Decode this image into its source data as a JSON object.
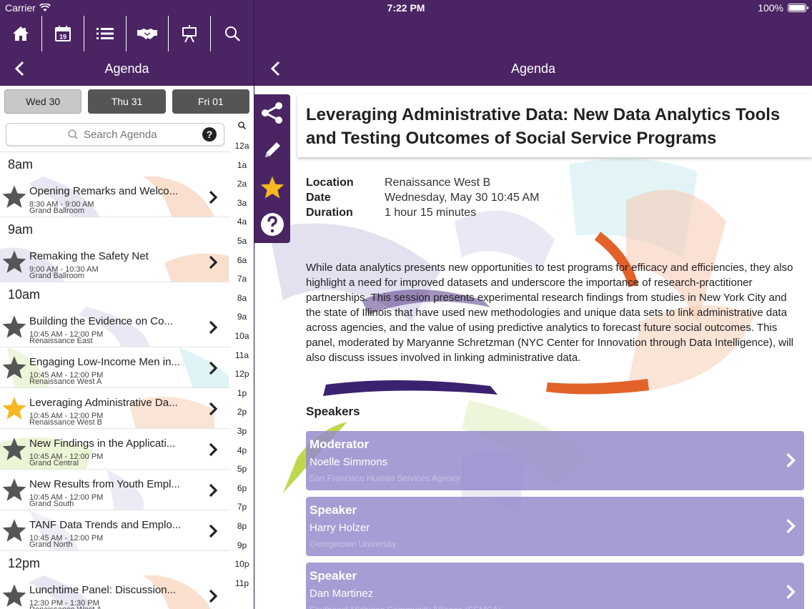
{
  "status_bar": {
    "carrier": "Carrier",
    "time": "7:22 PM",
    "battery": "100%",
    "battery_level": 1.0
  },
  "colors": {
    "header_purple": "#4a2463",
    "speaker_card": "#968ccd",
    "star_gold": "#f5b821",
    "star_gray": "#555555"
  },
  "toolbar": {
    "icons": [
      "home-icon",
      "calendar-icon",
      "list-icon",
      "handshake-icon",
      "presentation-icon",
      "search-icon"
    ],
    "calendar_day": "19"
  },
  "left_nav": {
    "title": "Agenda"
  },
  "day_tabs": [
    {
      "label": "Wed 30",
      "active": true
    },
    {
      "label": "Thu 31",
      "active": false
    },
    {
      "label": "Fri 01",
      "active": false
    }
  ],
  "search": {
    "placeholder": "Search Agenda",
    "help": "?"
  },
  "agenda": [
    {
      "hour": "8am",
      "sessions": [
        {
          "title": "Opening Remarks and Welco...",
          "time": "8:30 AM - 9:00 AM",
          "room": "Grand Ballroom",
          "starred": false
        }
      ]
    },
    {
      "hour": "9am",
      "sessions": [
        {
          "title": "Remaking the Safety Net",
          "time": "9:00 AM - 10:30 AM",
          "room": "Grand Ballroom",
          "starred": false
        }
      ]
    },
    {
      "hour": "10am",
      "sessions": [
        {
          "title": "Building the Evidence on Co...",
          "time": "10:45 AM - 12:00 PM",
          "room": "Renaissance East",
          "starred": false
        },
        {
          "title": "Engaging Low-Income Men in...",
          "time": "10:45 AM - 12:00 PM",
          "room": "Renaissance West A",
          "starred": false
        },
        {
          "title": "Leveraging Administrative Da...",
          "time": "10:45 AM - 12:00 PM",
          "room": "Renaissance West B",
          "starred": true
        },
        {
          "title": "New Findings in the Applicati...",
          "time": "10:45 AM - 12:00 PM",
          "room": "Grand Central",
          "starred": false
        },
        {
          "title": "New Results from Youth Empl...",
          "time": "10:45 AM - 12:00 PM",
          "room": "Grand South",
          "starred": false
        },
        {
          "title": "TANF Data Trends and Emplo...",
          "time": "10:45 AM - 12:00 PM",
          "room": "Grand North",
          "starred": false
        }
      ]
    },
    {
      "hour": "12pm",
      "sessions": [
        {
          "title": "Lunchtime Panel: Discussion...",
          "time": "12:30 PM - 1:30 PM",
          "room": "Renaissance West A",
          "starred": false
        }
      ]
    }
  ],
  "time_index": [
    "12a",
    "1a",
    "2a",
    "3a",
    "4a",
    "5a",
    "6a",
    "7a",
    "8a",
    "9a",
    "10a",
    "11a",
    "12p",
    "1p",
    "2p",
    "3p",
    "4p",
    "5p",
    "6p",
    "7p",
    "8p",
    "9p",
    "10p",
    "11p"
  ],
  "right_nav": {
    "title": "Agenda"
  },
  "detail": {
    "title": "Leveraging Administrative Data: New Data Analytics Tools and Testing Outcomes of Social Service Programs",
    "location_label": "Location",
    "location": "Renaissance West B",
    "date_label": "Date",
    "date": "Wednesday, May 30 10:45 AM",
    "duration_label": "Duration",
    "duration": "1 hour 15 minutes",
    "description": "While data analytics presents new opportunities to test programs for efficacy and efficiencies, they also highlight a need for improved datasets and underscore the importance of research-practitioner partnerships. This session presents experimental research findings from studies in New York City and the state of Illinois that have used new methodologies and unique data sets to link administrative data across agencies, and the value of using predictive analytics to forecast future social outcomes. This panel, moderated by Maryanne Schretzman (NYC Center for Innovation through Data Intelligence), will also discuss issues involved in linking administrative data.",
    "speakers_heading": "Speakers",
    "speakers": [
      {
        "role": "Moderator",
        "name": "Noelle Simmons",
        "org": "San Francisco Human Services Agency"
      },
      {
        "role": "Speaker",
        "name": "Harry Holzer",
        "org": "Georgetown University"
      },
      {
        "role": "Speaker",
        "name": "Dan Martinez",
        "org": "Southeast Michigan Community Alliance (SEMCA)"
      }
    ]
  }
}
